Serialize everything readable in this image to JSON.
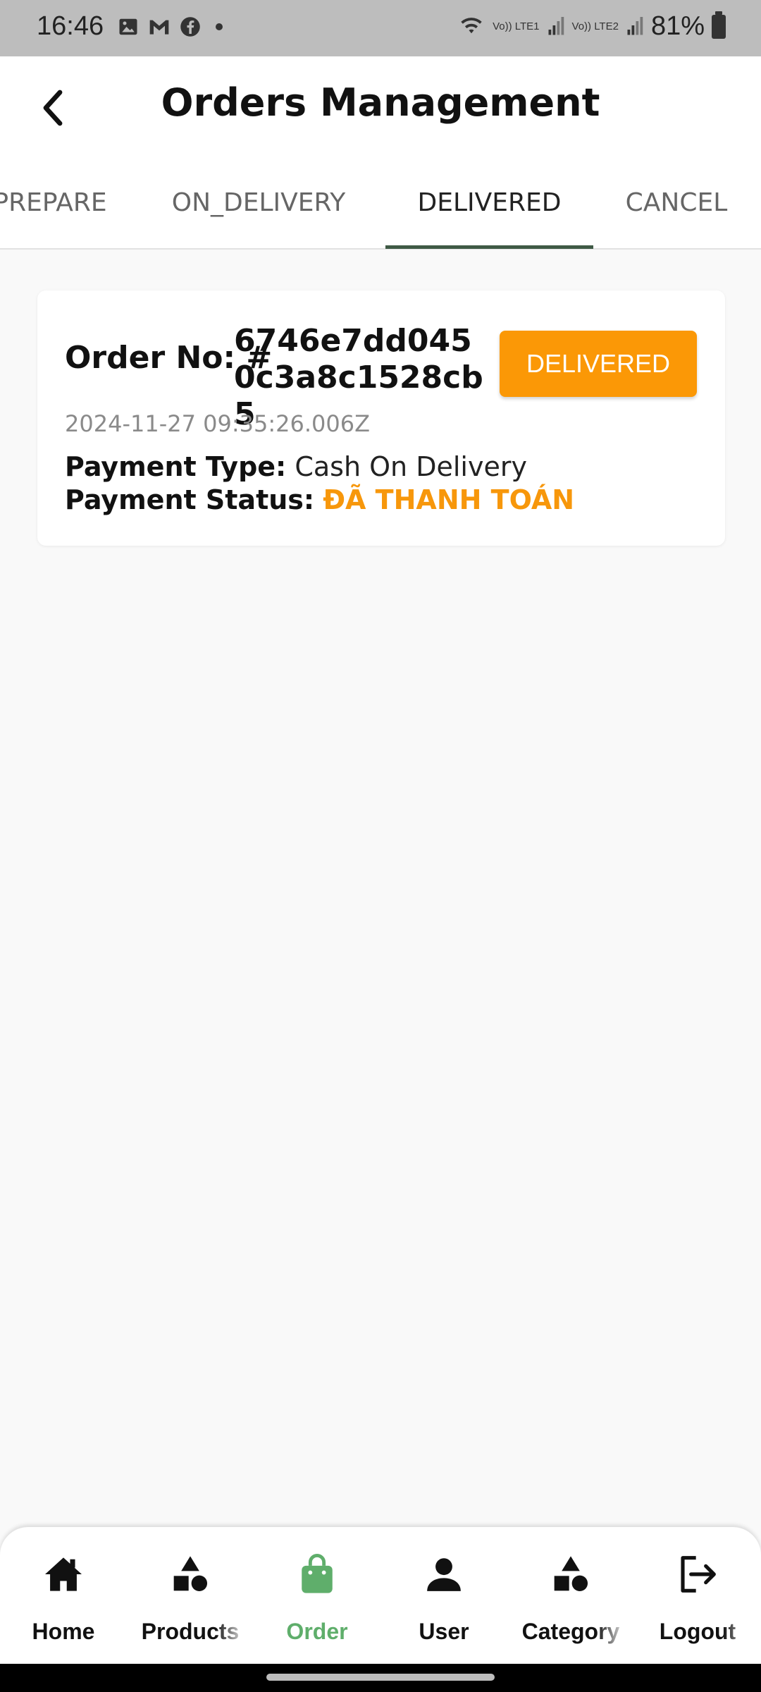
{
  "status_bar": {
    "time": "16:46",
    "battery": "81%",
    "sim1": "Vo)) LTE1",
    "sim2": "Vo)) LTE2"
  },
  "header": {
    "title": "Orders Management"
  },
  "tabs": [
    {
      "label": "PREPARE",
      "active": false
    },
    {
      "label": "ON_DELIVERY",
      "active": false
    },
    {
      "label": "DELIVERED",
      "active": true
    },
    {
      "label": "CANCEL",
      "active": false
    }
  ],
  "order": {
    "number_label": "Order No: #",
    "number": "6746e7dd0450c3a8c1528cb5",
    "status_button": "DELIVERED",
    "date": "2024-11-27 09:35:26.006Z",
    "payment_type_label": "Payment Type:",
    "payment_type": "Cash On Delivery",
    "payment_status_label": "Payment Status:",
    "payment_status": "ĐÃ THANH TOÁN"
  },
  "bottom_nav": [
    {
      "label": "Home",
      "icon": "home-icon",
      "active": false
    },
    {
      "label": "Products",
      "icon": "shapes-icon",
      "active": false
    },
    {
      "label": "Order",
      "icon": "shopping-bag-icon",
      "active": true
    },
    {
      "label": "User",
      "icon": "person-icon",
      "active": false
    },
    {
      "label": "Category",
      "icon": "shapes-icon",
      "active": false
    },
    {
      "label": "Logout",
      "icon": "logout-icon",
      "active": false
    }
  ],
  "colors": {
    "accent_orange": "#fb9806",
    "active_nav_green": "#5fae6b",
    "tab_indicator": "#3f5a45"
  }
}
